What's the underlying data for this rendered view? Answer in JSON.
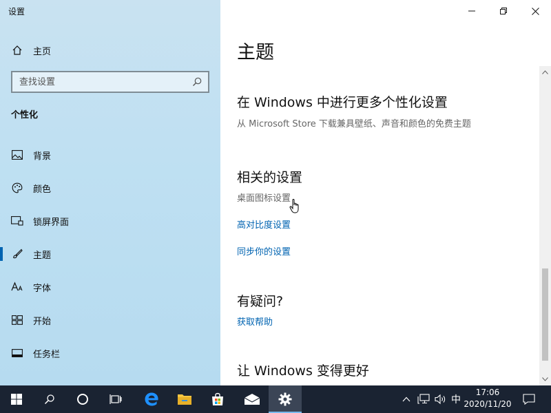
{
  "app": {
    "title": "设置"
  },
  "sidebar": {
    "home_label": "主页",
    "search": {
      "placeholder": "查找设置",
      "value": ""
    },
    "section_heading": "个性化",
    "items": [
      {
        "label": "背景",
        "icon": "image-icon"
      },
      {
        "label": "颜色",
        "icon": "palette-icon"
      },
      {
        "label": "锁屏界面",
        "icon": "lock-screen-icon"
      },
      {
        "label": "主题",
        "icon": "brush-icon",
        "active": true
      },
      {
        "label": "字体",
        "icon": "font-icon"
      },
      {
        "label": "开始",
        "icon": "start-grid-icon"
      },
      {
        "label": "任务栏",
        "icon": "taskbar-icon"
      }
    ]
  },
  "content": {
    "page_title": "主题",
    "personalize": {
      "title": "在 Windows 中进行更多个性化设置",
      "description": "从 Microsoft Store 下载兼具壁纸、声音和颜色的免费主题"
    },
    "related": {
      "title": "相关的设置",
      "links": [
        "桌面图标设置",
        "高对比度设置",
        "同步你的设置"
      ]
    },
    "questions": {
      "title": "有疑问?",
      "link": "获取帮助"
    },
    "better": {
      "title": "让 Windows 变得更好"
    }
  },
  "taskbar": {
    "ime": "中",
    "time": "17:06",
    "date": "2020/11/20"
  },
  "colors": {
    "accent": "#0063b1",
    "sidebar_bg": "#bfe0f2",
    "taskbar_bg": "#1a2332"
  }
}
